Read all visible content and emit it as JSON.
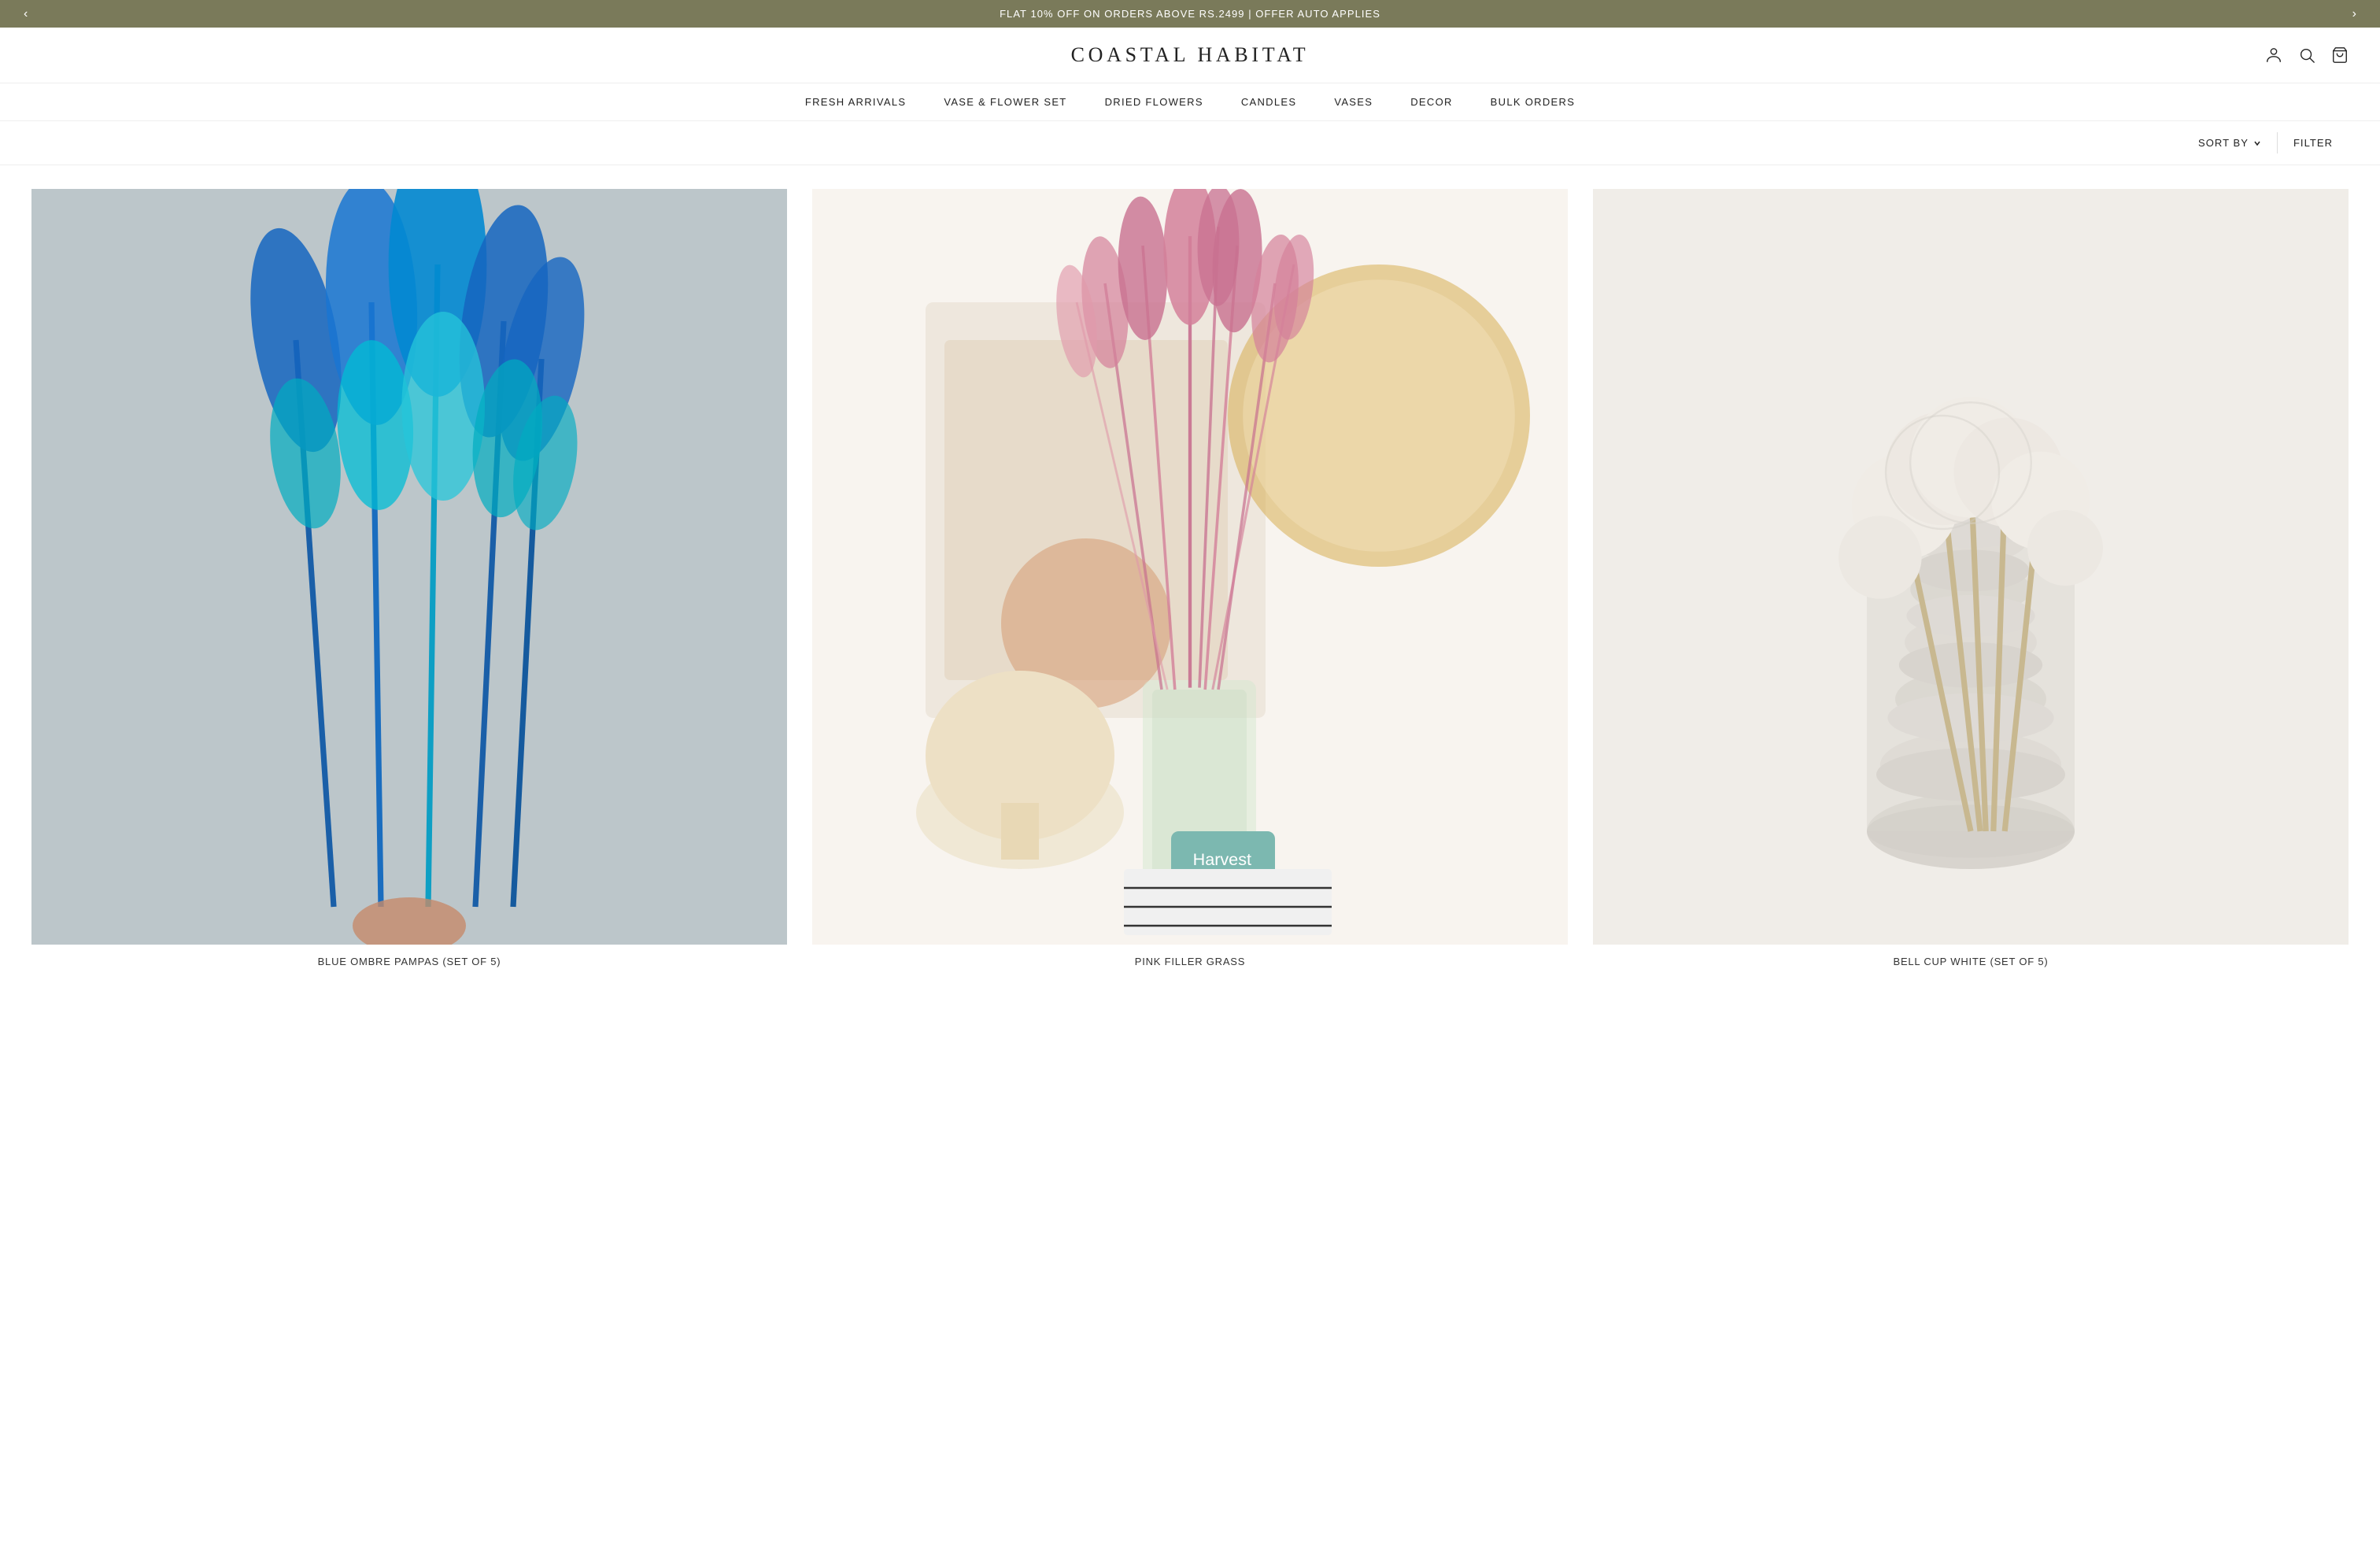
{
  "announcement": {
    "text": "FLAT 10% OFF ON ORDERS ABOVE RS.2499 | OFFER AUTO APPLIES",
    "prev_label": "‹",
    "next_label": "›"
  },
  "header": {
    "logo": "COASTAL HABITAT",
    "icons": {
      "account": "person-icon",
      "search": "search-icon",
      "cart": "bag-icon"
    }
  },
  "nav": {
    "items": [
      {
        "label": "FRESH ARRIVALS",
        "id": "fresh-arrivals"
      },
      {
        "label": "VASE & FLOWER SET",
        "id": "vase-flower-set"
      },
      {
        "label": "DRIED FLOWERS",
        "id": "dried-flowers"
      },
      {
        "label": "CANDLES",
        "id": "candles"
      },
      {
        "label": "VASES",
        "id": "vases"
      },
      {
        "label": "DECOR",
        "id": "decor"
      },
      {
        "label": "BULK ORDERS",
        "id": "bulk-orders"
      }
    ]
  },
  "toolbar": {
    "sort_by_label": "SORT BY",
    "filter_label": "FILTER"
  },
  "products": [
    {
      "id": "product-1",
      "name": "BLUE OMBRE PAMPAS (SET OF 5)",
      "image_type": "blue",
      "alt": "Blue ombre pampas grass bundle"
    },
    {
      "id": "product-2",
      "name": "PINK FILLER GRASS",
      "image_type": "pink",
      "alt": "Pink filler grass in vase with candle"
    },
    {
      "id": "product-3",
      "name": "BELL CUP WHITE (SET OF 5)",
      "image_type": "white",
      "alt": "White bell cup dried flowers in vase"
    }
  ],
  "colors": {
    "announcement_bg": "#7a7a5a",
    "accent": "#222222"
  }
}
